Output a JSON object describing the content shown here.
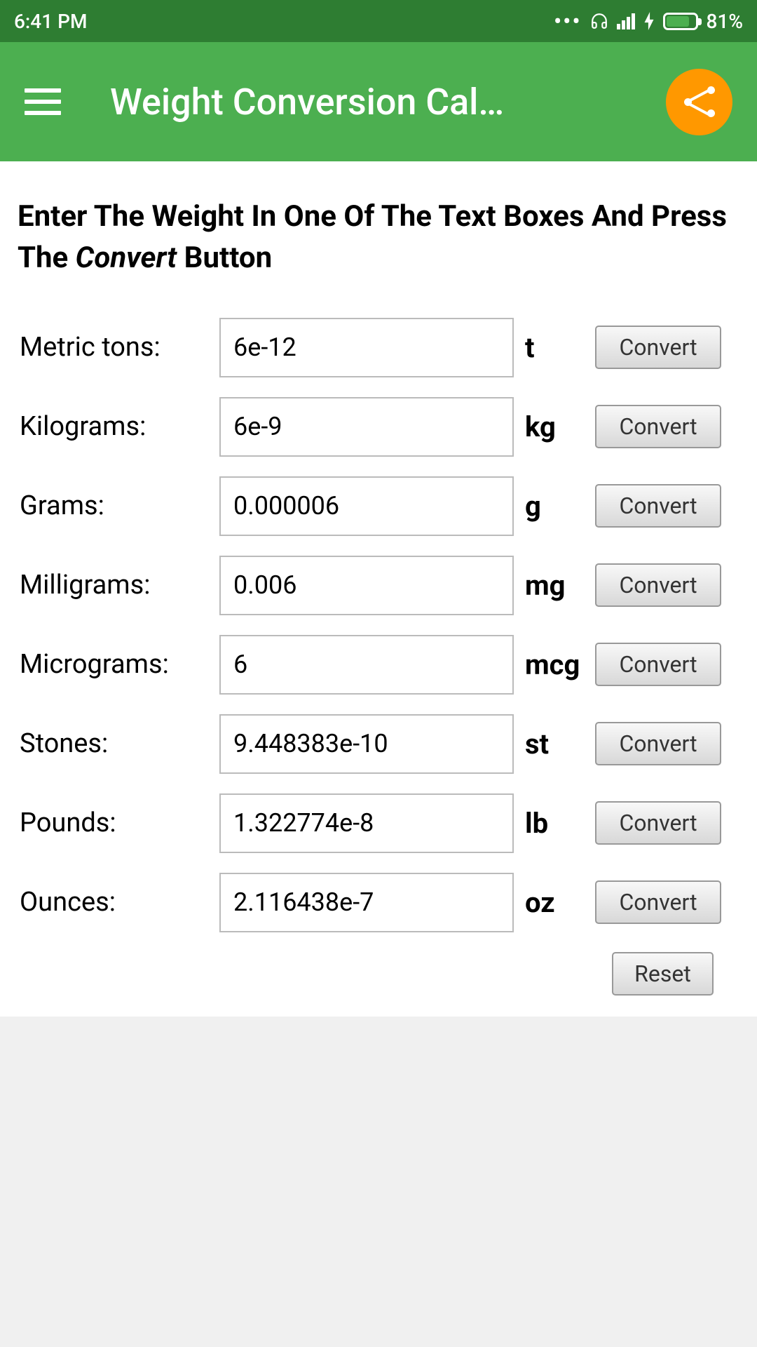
{
  "status_bar": {
    "time": "6:41 PM",
    "battery_percent": "81%"
  },
  "header": {
    "title": "Weight Conversion Cal…"
  },
  "instructions": {
    "prefix": "Enter The Weight In One Of The Text Boxes And Press The ",
    "emphasis": "Convert",
    "suffix": " Button"
  },
  "rows": [
    {
      "label": "Metric tons:",
      "value": "6e-12",
      "unit": "t",
      "button": "Convert"
    },
    {
      "label": "Kilograms:",
      "value": "6e-9",
      "unit": "kg",
      "button": "Convert"
    },
    {
      "label": "Grams:",
      "value": "0.000006",
      "unit": "g",
      "button": "Convert"
    },
    {
      "label": "Milligrams:",
      "value": "0.006",
      "unit": "mg",
      "button": "Convert"
    },
    {
      "label": "Micrograms:",
      "value": "6",
      "unit": "mcg",
      "button": "Convert"
    },
    {
      "label": "Stones:",
      "value": "9.448383e-10",
      "unit": "st",
      "button": "Convert"
    },
    {
      "label": "Pounds:",
      "value": "1.322774e-8",
      "unit": "lb",
      "button": "Convert"
    },
    {
      "label": "Ounces:",
      "value": "2.116438e-7",
      "unit": "oz",
      "button": "Convert"
    }
  ],
  "reset_button": "Reset"
}
